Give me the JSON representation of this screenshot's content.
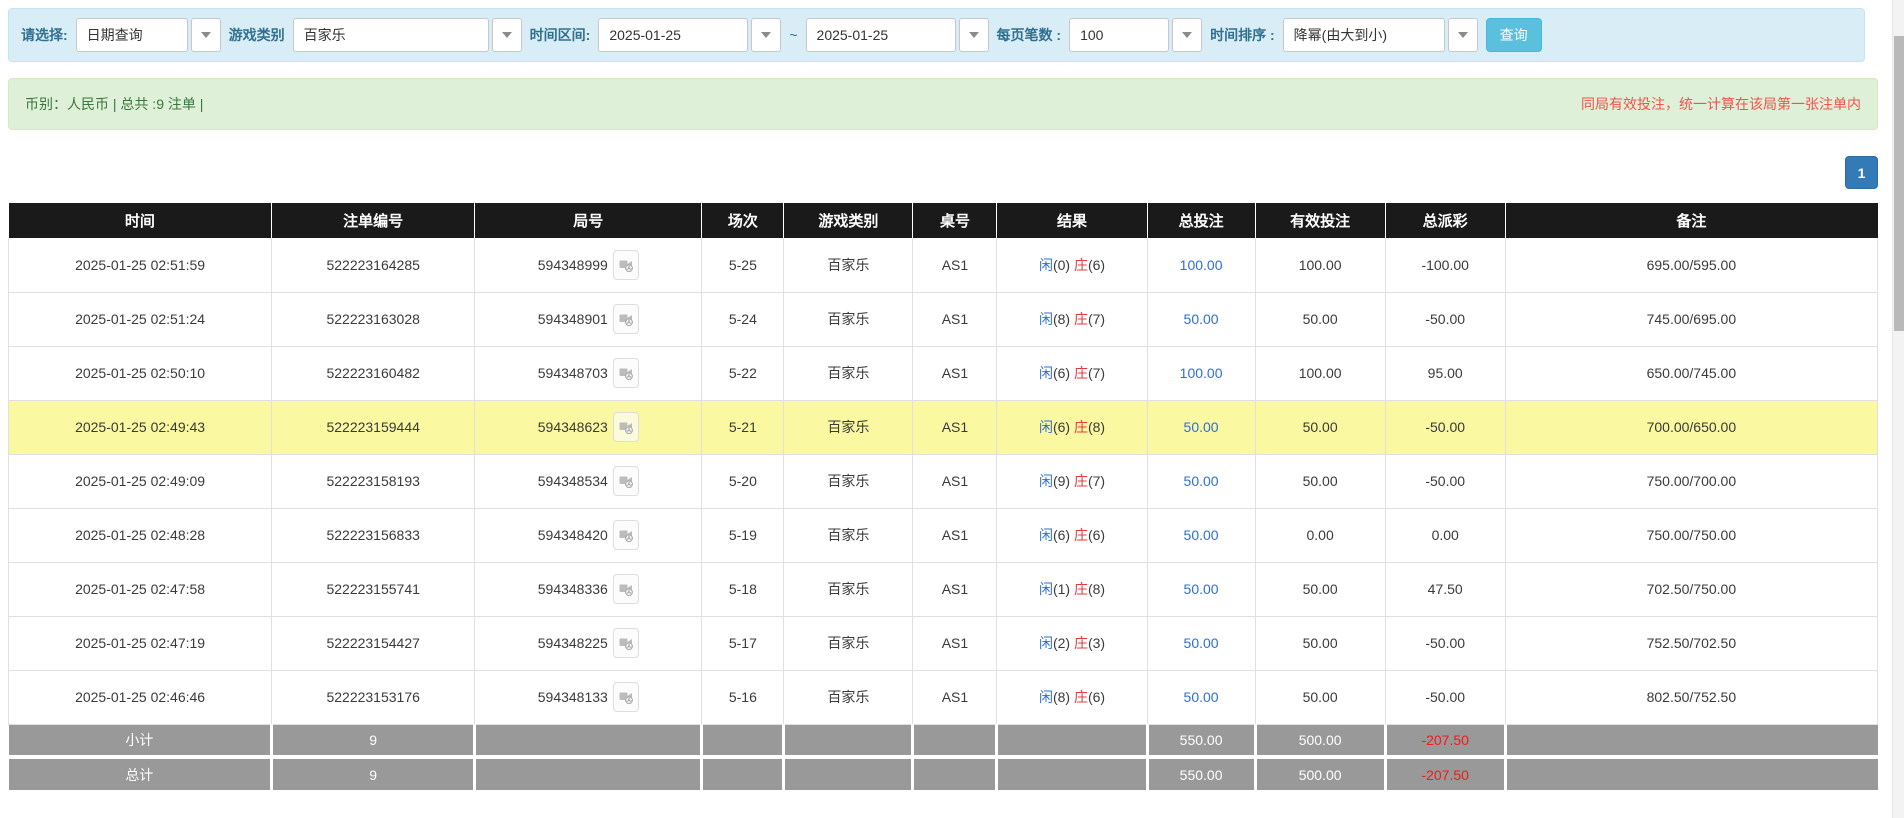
{
  "filter_bar": {
    "select_label": "请选择:",
    "select_value": "日期查询",
    "game_category_label": "游戏类别",
    "game_category_value": "百家乐",
    "time_range_label": "时间区间:",
    "date_from": "2025-01-25",
    "range_separator": "~",
    "date_to": "2025-01-25",
    "page_size_label": "每页笔数 :",
    "page_size_value": "100",
    "time_sort_label": "时间排序 :",
    "time_sort_value": "降幂(由大到小)",
    "query_button_label": "查询"
  },
  "summary_bar": {
    "info_text": "币别：人民币 | 总共 :9 注单 |",
    "notice_text": "同局有效投注，统一计算在该局第一张注单内"
  },
  "pagination": {
    "current_page": "1"
  },
  "table": {
    "headers": [
      "时间",
      "注单编号",
      "局号",
      "场次",
      "游戏类别",
      "桌号",
      "结果",
      "总投注",
      "有效投注",
      "总派彩",
      "备注"
    ],
    "rows": [
      {
        "time": "2025-01-25 02:51:59",
        "bet_id": "522223164285",
        "round_id": "594348999",
        "session": "5-25",
        "game": "百家乐",
        "table_no": "AS1",
        "result_player": "闲(0)",
        "result_banker": "庄(6)",
        "total_bet": "100.00",
        "valid_bet": "100.00",
        "total_payout": "-100.00",
        "remark": "695.00/595.00",
        "highlighted": false
      },
      {
        "time": "2025-01-25 02:51:24",
        "bet_id": "522223163028",
        "round_id": "594348901",
        "session": "5-24",
        "game": "百家乐",
        "table_no": "AS1",
        "result_player": "闲(8)",
        "result_banker": "庄(7)",
        "total_bet": "50.00",
        "valid_bet": "50.00",
        "total_payout": "-50.00",
        "remark": "745.00/695.00",
        "highlighted": false
      },
      {
        "time": "2025-01-25 02:50:10",
        "bet_id": "522223160482",
        "round_id": "594348703",
        "session": "5-22",
        "game": "百家乐",
        "table_no": "AS1",
        "result_player": "闲(6)",
        "result_banker": "庄(7)",
        "total_bet": "100.00",
        "valid_bet": "100.00",
        "total_payout": "95.00",
        "remark": "650.00/745.00",
        "highlighted": false
      },
      {
        "time": "2025-01-25 02:49:43",
        "bet_id": "522223159444",
        "round_id": "594348623",
        "session": "5-21",
        "game": "百家乐",
        "table_no": "AS1",
        "result_player": "闲(6)",
        "result_banker": "庄(8)",
        "total_bet": "50.00",
        "valid_bet": "50.00",
        "total_payout": "-50.00",
        "remark": "700.00/650.00",
        "highlighted": true
      },
      {
        "time": "2025-01-25 02:49:09",
        "bet_id": "522223158193",
        "round_id": "594348534",
        "session": "5-20",
        "game": "百家乐",
        "table_no": "AS1",
        "result_player": "闲(9)",
        "result_banker": "庄(7)",
        "total_bet": "50.00",
        "valid_bet": "50.00",
        "total_payout": "-50.00",
        "remark": "750.00/700.00",
        "highlighted": false
      },
      {
        "time": "2025-01-25 02:48:28",
        "bet_id": "522223156833",
        "round_id": "594348420",
        "session": "5-19",
        "game": "百家乐",
        "table_no": "AS1",
        "result_player": "闲(6)",
        "result_banker": "庄(6)",
        "total_bet": "50.00",
        "valid_bet": "0.00",
        "total_payout": "0.00",
        "remark": "750.00/750.00",
        "highlighted": false
      },
      {
        "time": "2025-01-25 02:47:58",
        "bet_id": "522223155741",
        "round_id": "594348336",
        "session": "5-18",
        "game": "百家乐",
        "table_no": "AS1",
        "result_player": "闲(1)",
        "result_banker": "庄(8)",
        "total_bet": "50.00",
        "valid_bet": "50.00",
        "total_payout": "47.50",
        "remark": "702.50/750.00",
        "highlighted": false
      },
      {
        "time": "2025-01-25 02:47:19",
        "bet_id": "522223154427",
        "round_id": "594348225",
        "session": "5-17",
        "game": "百家乐",
        "table_no": "AS1",
        "result_player": "闲(2)",
        "result_banker": "庄(3)",
        "total_bet": "50.00",
        "valid_bet": "50.00",
        "total_payout": "-50.00",
        "remark": "752.50/702.50",
        "highlighted": false
      },
      {
        "time": "2025-01-25 02:46:46",
        "bet_id": "522223153176",
        "round_id": "594348133",
        "session": "5-16",
        "game": "百家乐",
        "table_no": "AS1",
        "result_player": "闲(8)",
        "result_banker": "庄(6)",
        "total_bet": "50.00",
        "valid_bet": "50.00",
        "total_payout": "-50.00",
        "remark": "802.50/752.50",
        "highlighted": false
      }
    ],
    "subtotal_row": {
      "label": "小计",
      "count": "9",
      "total_bet": "550.00",
      "valid_bet": "500.00",
      "total_payout": "-207.50"
    },
    "total_row": {
      "label": "总计",
      "count": "9",
      "total_bet": "550.00",
      "valid_bet": "500.00",
      "total_payout": "-207.50"
    }
  },
  "icons": {
    "dropdown_caret": "chevron-down",
    "video_icon": "video-replay"
  },
  "colors": {
    "filter_bar_bg": "#d9edf7",
    "filter_label_text": "#31708f",
    "query_button_bg": "#5bc0de",
    "summary_bar_bg": "#dff0d8",
    "summary_info_text": "#3c763d",
    "notice_text": "#f4524a",
    "pagination_bg": "#337ab7",
    "table_header_bg": "#1a1a1a",
    "highlight_row_bg": "#fbf8a2",
    "summary_row_bg": "#999999",
    "player_blue": "#2b6fd9",
    "banker_red": "#e4393c",
    "negative_red": "#f01b1b",
    "link_blue": "#2b6fd9"
  }
}
